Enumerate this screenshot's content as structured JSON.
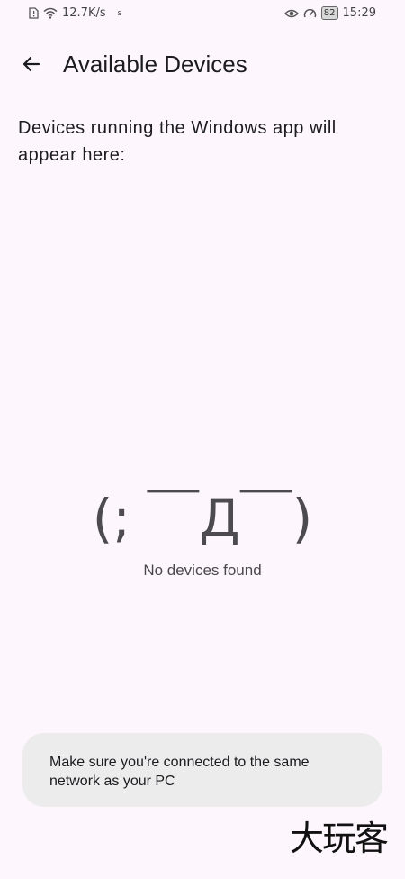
{
  "status_bar": {
    "network_speed": "12.7K/s",
    "small_indicator": "s",
    "battery": "82",
    "time": "15:29"
  },
  "app_bar": {
    "title": "Available Devices",
    "back_icon": "arrow-left-icon"
  },
  "main": {
    "description": "Devices running the Windows app will appear here:",
    "empty_state": {
      "face": "(; ￣Д￣)",
      "message": "No devices found"
    }
  },
  "hint_card": {
    "text": "Make sure you're connected to the same network as your PC"
  },
  "watermark": {
    "text": "大玩客"
  }
}
